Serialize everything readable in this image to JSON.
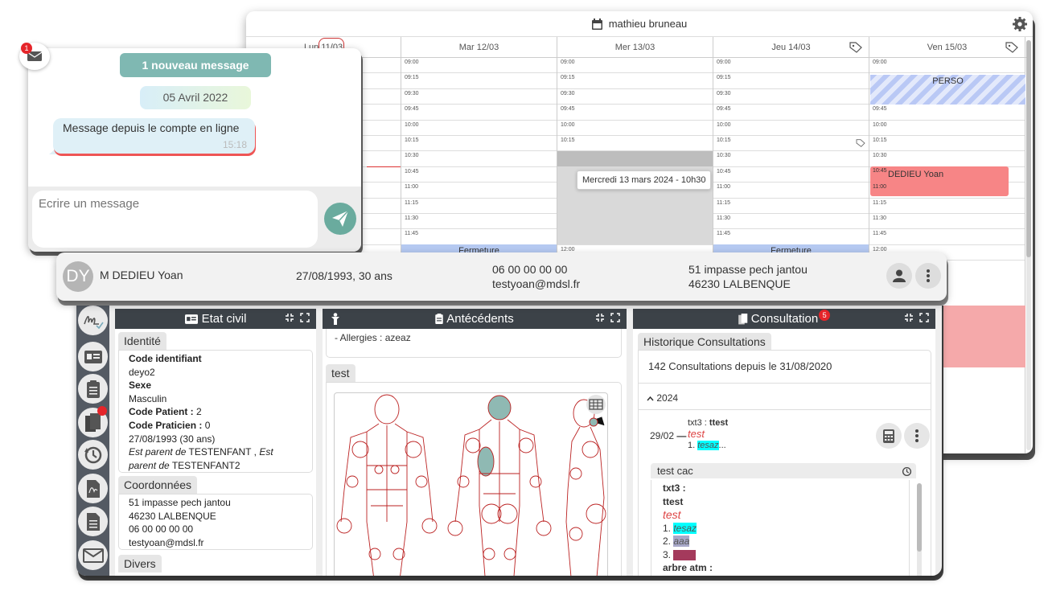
{
  "calendar": {
    "practitioner": "mathieu bruneau",
    "days": [
      "Lun 11/03",
      "Mar 12/03",
      "Mer 13/03",
      "Jeu 14/03",
      "Ven 15/03"
    ],
    "times": [
      "09:00",
      "09:15",
      "09:30",
      "09:45",
      "10:00",
      "10:15",
      "10:30",
      "10:45",
      "11:00",
      "11:15",
      "11:30",
      "11:45",
      "12:00"
    ],
    "events": {
      "perso": "PERSO",
      "patient_event_time": "10:45",
      "patient_event_time2": "11:00",
      "patient_event": "DEDIEU Yoan",
      "fermeture": "Fermeture",
      "tooltip": "Mercredi 13 mars 2024 - 10h30"
    }
  },
  "chat": {
    "unread_count": "1",
    "new_message_banner": "1 nouveau message",
    "date": "05 Avril 2022",
    "message": "Message depuis le compte en ligne",
    "message_time": "15:18",
    "input_placeholder": "Ecrire un message"
  },
  "patient": {
    "initials": "DY",
    "name": "M DEDIEU Yoan",
    "birth": "27/08/1993, 30 ans",
    "phone": "06 00 00 00 00",
    "email": "testyoan@mdsl.fr",
    "address_line1": "51 impasse pech jantou",
    "address_line2": "46230 LALBENQUE"
  },
  "etat_civil": {
    "title": "Etat civil",
    "identite_tab": "Identité",
    "code_identifiant_label": "Code identifiant",
    "code_identifiant": "deyo2",
    "sexe_label": "Sexe",
    "sexe": "Masculin",
    "code_patient_label": "Code Patient :",
    "code_patient": " 2",
    "code_praticien_label": "Code Praticien :",
    "code_praticien": " 0",
    "birth": "27/08/1993 (30 ans)",
    "parent_prefix": "Est parent de",
    "parent1": " TESTENFANT , ",
    "parent_prefix2": "Est parent de",
    "parent2": " TESTENFANT2",
    "coordonnees_tab": "Coordonnées",
    "addr1": "51 impasse pech jantou",
    "addr2": "46230 LALBENQUE",
    "phone": "06 00 00 00 00",
    "email": "testyoan@mdsl.fr",
    "divers_tab": "Divers"
  },
  "antecedents": {
    "title": "Antécédents",
    "allergies": "- Allergies : azeaz",
    "test_tab": "test"
  },
  "consultation": {
    "title": "Consultation",
    "badge": "5",
    "history_tab": "Historique Consultations",
    "summary": "142 Consultations depuis le 31/08/2020",
    "year": "2024",
    "entry_date": "29/02",
    "entry_txt3_label": "txt3 : ",
    "entry_txt3": "ttest",
    "entry_test": "test",
    "entry_item_num": "1. ",
    "entry_item": "tesaz",
    "entry_item_suffix": "...",
    "detail_tab": "test cac",
    "detail_txt3_label": "txt3 :",
    "detail_ttest": "ttest",
    "detail_test": "test",
    "detail_items": [
      "1. ",
      "2. ",
      "3. "
    ],
    "detail_item_values": [
      "tesaz",
      "aaa",
      ""
    ],
    "detail_next": "arbre atm :"
  }
}
